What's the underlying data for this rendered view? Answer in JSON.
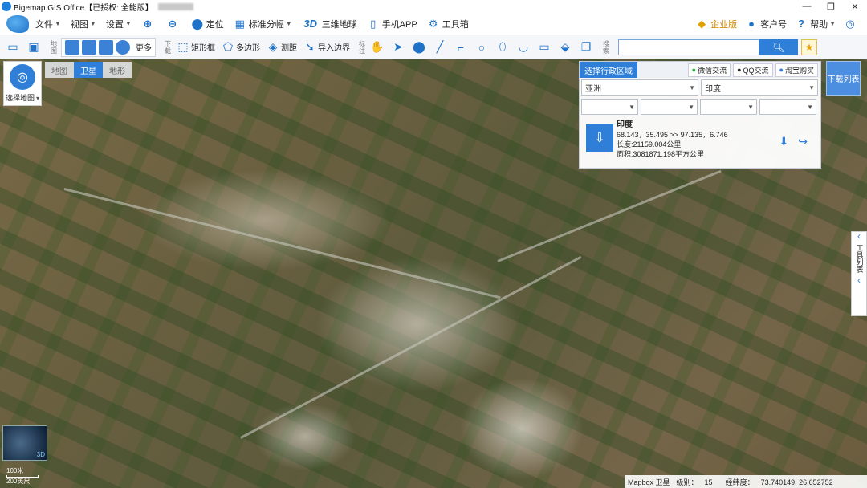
{
  "window": {
    "title": "Bigemap GIS Office【已授权: 全能版】",
    "controls": [
      "—",
      "❐",
      "✕"
    ]
  },
  "menu": {
    "items": [
      {
        "label": "文件",
        "icon": "file-menu"
      },
      {
        "label": "视图",
        "icon": "view-menu"
      },
      {
        "label": "设置",
        "icon": "settings-menu"
      },
      {
        "label": "",
        "icon": "zoom-in-icon"
      },
      {
        "label": "",
        "icon": "zoom-out-icon"
      },
      {
        "label": "定位",
        "icon": "location-pin-icon"
      },
      {
        "label": "标准分幅",
        "icon": "grid-icon"
      },
      {
        "label": "三维地球",
        "icon": "3d-icon"
      },
      {
        "label": "手机APP",
        "icon": "phone-icon"
      },
      {
        "label": "工具箱",
        "icon": "gear-icon"
      }
    ],
    "right": [
      {
        "label": "企业版",
        "icon": "enterprise-icon"
      },
      {
        "label": "客户号",
        "icon": "user-icon"
      },
      {
        "label": "帮助",
        "icon": "help-icon"
      }
    ]
  },
  "toolbar": {
    "map_section_label": "地图",
    "download_section_label": "下载",
    "mark_section_label": "标注",
    "search_section_label": "搜索",
    "more_label": "更多",
    "rect_label": "矩形框",
    "polygon_label": "多边形",
    "measure_label": "测距",
    "import_label": "导入边界",
    "search_placeholder": ""
  },
  "map": {
    "types": [
      {
        "label": "地图",
        "active": false
      },
      {
        "label": "卫星",
        "active": true
      },
      {
        "label": "地形",
        "active": false
      }
    ],
    "select_map_label": "选择地图",
    "download_list_label": "下载列表",
    "tool_list_label": "工具列表",
    "scale_m": "100米",
    "scale_ft": "200英尺",
    "minimap_3d": "3D"
  },
  "admin_panel": {
    "tab_label": "选择行政区域",
    "wechat_label": "微信交流",
    "qq_label": "QQ交流",
    "taobao_label": "淘宝购买",
    "continent": "亚洲",
    "country": "印度",
    "result": {
      "name": "印度",
      "bounds": "68.143，35.495 >> 97.135，6.746",
      "length": "长度:21159.004公里",
      "area": "面积:3081871.198平方公里"
    }
  },
  "status": {
    "source": "Mapbox 卫星",
    "level_label": "级别：",
    "level": "15",
    "coord_label": "经纬度：",
    "coords": "73.740149, 26.652752"
  }
}
